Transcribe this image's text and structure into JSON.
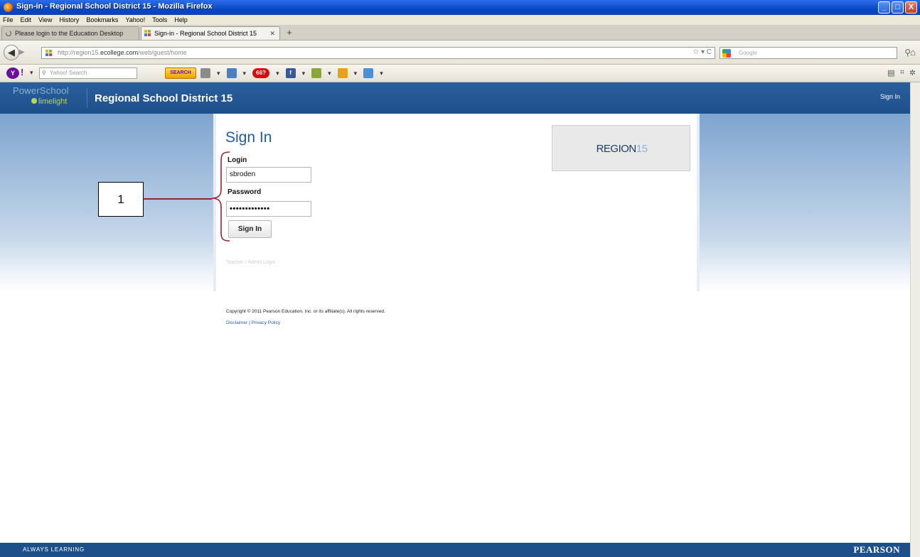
{
  "window": {
    "title": "Sign-in - Regional School District 15 - Mozilla Firefox",
    "controls": [
      "_",
      "□",
      "X"
    ]
  },
  "menu": [
    "File",
    "Edit",
    "View",
    "History",
    "Bookmarks",
    "Yahoo!",
    "Tools",
    "Help"
  ],
  "tabs": [
    {
      "label": "Please login to the Education Desktop",
      "active": false
    },
    {
      "label": "Sign-in - Regional School District 15",
      "active": true
    }
  ],
  "nav": {
    "url_prefix": "http://region15.",
    "url_domain": "ecollege.com",
    "url_path": "/web/guest/home",
    "search_placeholder": "Google"
  },
  "yahoo": {
    "logo": "Y",
    "search_placeholder": "Yahoo! Search",
    "search_button": "SEARCH",
    "mail_count": "66?"
  },
  "site": {
    "brand_top": "PowerSchool",
    "brand_bottom": "limelight",
    "district_name": "Regional School District 15",
    "signin_link": "Sign In"
  },
  "form": {
    "heading": "Sign In",
    "login_label": "Login",
    "login_value": "sbroden",
    "password_label": "Password",
    "password_value": "•••••••••••••",
    "submit_label": "Sign In",
    "admin_link": "Teacher / Admin Login"
  },
  "region_logo": {
    "word": "REGION",
    "number": "15"
  },
  "footer": {
    "copyright": "Copyright © 2011 Pearson Education, Inc. or its affiliate(s). All rights reserved.",
    "disclaimer": "Disclaimer",
    "separator": "|",
    "privacy": "Privacy Policy"
  },
  "bottom": {
    "tagline": "ALWAYS LEARNING",
    "brand": "PEARSON"
  },
  "annotation": {
    "number": "1"
  },
  "colors": {
    "banner": "#1d4f8a",
    "heading": "#1e5c9a",
    "annotation_line": "#a0202a"
  }
}
